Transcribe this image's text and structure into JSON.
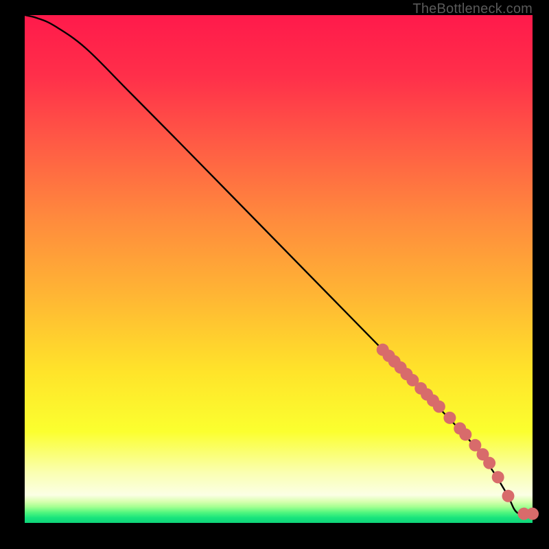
{
  "watermark": "TheBottleneck.com",
  "gradient_stops": [
    {
      "offset": 0.0,
      "color": "#ff1a4b"
    },
    {
      "offset": 0.12,
      "color": "#ff2f4a"
    },
    {
      "offset": 0.25,
      "color": "#ff5a45"
    },
    {
      "offset": 0.4,
      "color": "#ff8a3d"
    },
    {
      "offset": 0.55,
      "color": "#ffb534"
    },
    {
      "offset": 0.7,
      "color": "#ffe32a"
    },
    {
      "offset": 0.82,
      "color": "#fbff2f"
    },
    {
      "offset": 0.9,
      "color": "#faffb0"
    },
    {
      "offset": 0.945,
      "color": "#fbffe5"
    },
    {
      "offset": 0.958,
      "color": "#d8ffb0"
    },
    {
      "offset": 0.968,
      "color": "#a6ff92"
    },
    {
      "offset": 0.979,
      "color": "#54f77f"
    },
    {
      "offset": 0.99,
      "color": "#18e47c"
    },
    {
      "offset": 1.0,
      "color": "#0fd47a"
    }
  ],
  "marker_color": "#d86b6b",
  "marker_radius": 9,
  "chart_data": {
    "type": "line",
    "title": "",
    "xlabel": "",
    "ylabel": "",
    "xlim": [
      0,
      100
    ],
    "ylim": [
      0,
      100
    ],
    "series": [
      {
        "name": "curve",
        "x": [
          0,
          2.5,
          6,
          12,
          20,
          30,
          40,
          50,
          60,
          70,
          76,
          82,
          88,
          92,
          95,
          97,
          100
        ],
        "y": [
          100,
          99.4,
          97.8,
          93.5,
          85.5,
          75.4,
          65.2,
          55.0,
          44.8,
          34.6,
          28.4,
          22.2,
          15.8,
          10.5,
          5.6,
          2.0,
          1.8
        ]
      }
    ],
    "markers": {
      "name": "highlighted-points",
      "x": [
        70.5,
        71.7,
        72.8,
        74.0,
        75.2,
        76.4,
        78.0,
        79.2,
        80.4,
        81.6,
        83.7,
        85.7,
        86.8,
        88.7,
        90.2,
        91.5,
        93.2,
        95.2,
        98.3,
        100.0
      ],
      "y": [
        34.1,
        32.9,
        31.8,
        30.6,
        29.3,
        28.1,
        26.5,
        25.3,
        24.1,
        22.9,
        20.7,
        18.6,
        17.4,
        15.3,
        13.5,
        11.8,
        9.0,
        5.3,
        1.8,
        1.8
      ]
    }
  }
}
